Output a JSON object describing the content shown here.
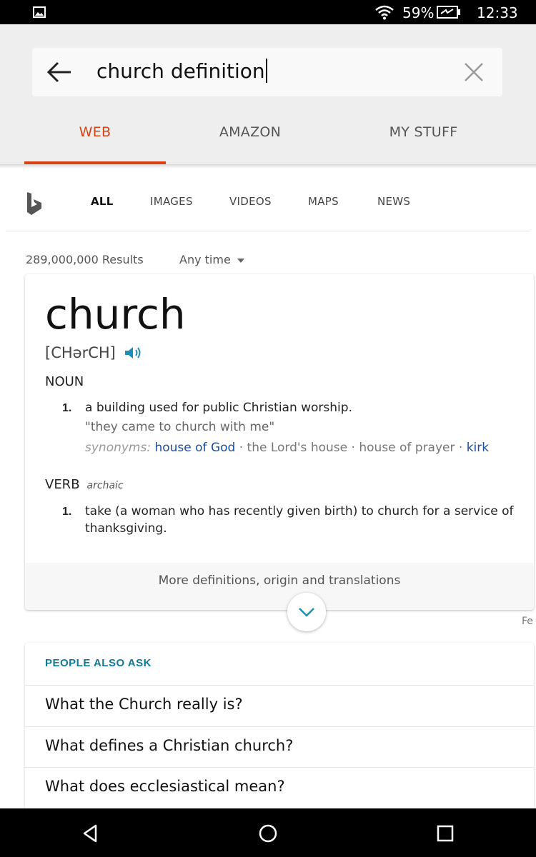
{
  "status_bar": {
    "battery_percent": "59%",
    "time": "12:33"
  },
  "search": {
    "query": "church definition"
  },
  "app_tabs": [
    {
      "label": "WEB",
      "active": true
    },
    {
      "label": "AMAZON",
      "active": false
    },
    {
      "label": "MY STUFF",
      "active": false
    }
  ],
  "bing_nav": [
    {
      "label": "ALL",
      "active": true
    },
    {
      "label": "IMAGES",
      "active": false
    },
    {
      "label": "VIDEOS",
      "active": false
    },
    {
      "label": "MAPS",
      "active": false
    },
    {
      "label": "NEWS",
      "active": false
    }
  ],
  "results": {
    "count": "289,000,000 Results",
    "time_filter": "Any time"
  },
  "dictionary": {
    "word": "church",
    "pronunciation": "[CHərCH]",
    "noun": {
      "label": "NOUN",
      "number": "1.",
      "definition": "a building used for public Christian worship.",
      "example": "\"they came to church with me\"",
      "synonyms_label": "synonyms:",
      "synonyms": [
        "house of God",
        "the Lord's house",
        "house of prayer",
        "kirk"
      ]
    },
    "verb": {
      "label": "VERB",
      "note": "archaic",
      "number": "1.",
      "definition": "take (a woman who has recently given birth) to church for a service of thanksgiving."
    },
    "more_label": "More definitions, origin and translations",
    "side_peek": "Fe"
  },
  "people_also_ask": {
    "title": "PEOPLE ALSO ASK",
    "questions": [
      "What the Church really is?",
      "What defines a Christian church?",
      "What does ecclesiastical mean?"
    ]
  },
  "colors": {
    "accent": "#d84315",
    "link": "#1a4ea3",
    "teal": "#0e7c96"
  }
}
